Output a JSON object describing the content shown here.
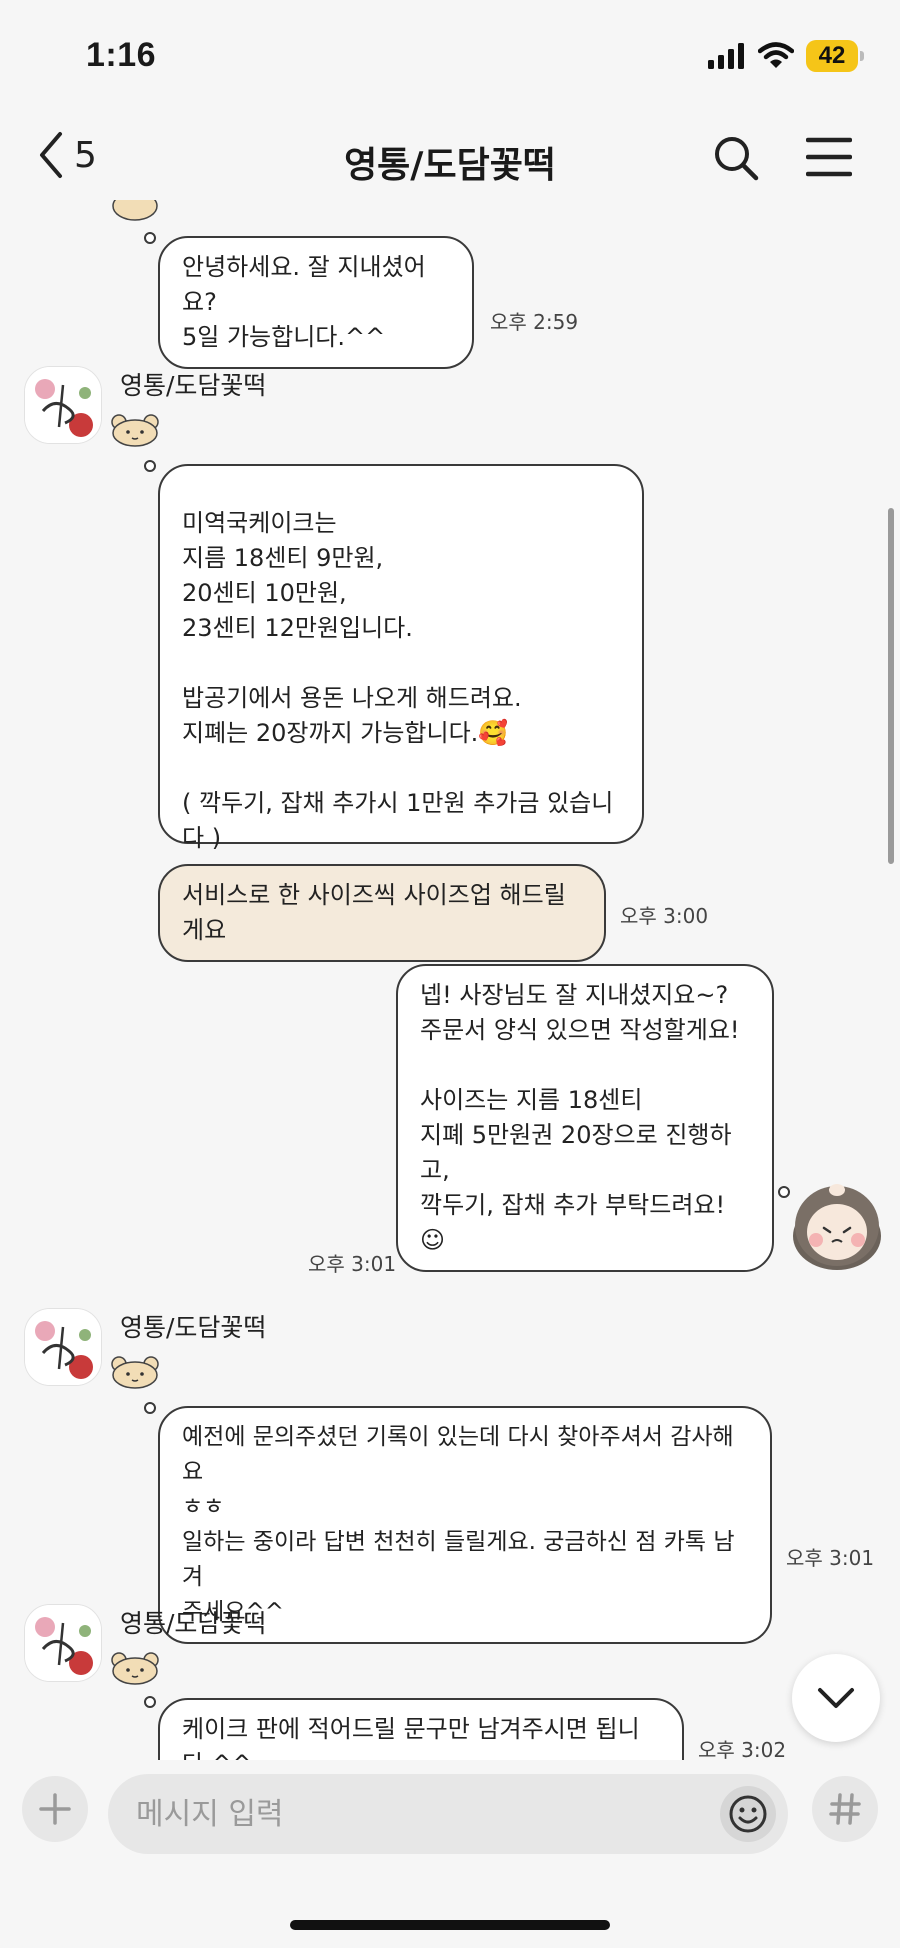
{
  "status_bar": {
    "time": "1:16",
    "battery": "42",
    "icons": [
      "signal-icon",
      "wifi-icon",
      "battery-icon"
    ],
    "battery_color": "#f5c518"
  },
  "header": {
    "back_count": "5",
    "title": "영통/도담꽃떡",
    "icons": [
      "back-arrow-icon",
      "search-icon",
      "menu-icon"
    ]
  },
  "messages": [
    {
      "id": "m1",
      "side": "received",
      "text": "안녕하세요. 잘 지내셨어요?\n5일 가능합니다.^^",
      "time": "오후 2:59"
    },
    {
      "id": "m2",
      "side": "received",
      "sender": "영통/도담꽃떡",
      "text": "미역국케이크는\n지름 18센티 9만원,\n20센티 10만원,\n23센티 12만원입니다.\n\n밥공기에서 용돈 나오게 해드려요.\n지폐는 20장까지 가능합니다.🥰\n\n( 깍두기, 잡채 추가시 1만원 추가금 있습니다 )"
    },
    {
      "id": "m3",
      "side": "received",
      "style": "beige",
      "text": "서비스로 한 사이즈씩 사이즈업 해드릴게요",
      "time": "오후 3:00"
    },
    {
      "id": "m4",
      "side": "sent",
      "text": "넵! 사장님도 잘 지내셨지요~?\n주문서 양식 있으면 작성할게요!\n\n사이즈는 지름 18센티\n지폐 5만원권 20장으로 진행하고,\n깍두기, 잡채 추가 부탁드려요! ☺",
      "time": "오후 3:01"
    },
    {
      "id": "m5",
      "side": "received",
      "sender": "영통/도담꽃떡",
      "text": "예전에 문의주셨던 기록이 있는데 다시 찾아주셔서 감사해요\nㅎㅎ\n일하는 중이라 답변 천천히 들릴게요. 궁금하신 점 카톡 남겨\n주세요^^",
      "time": "오후 3:01"
    },
    {
      "id": "m6",
      "side": "received",
      "sender": "영통/도담꽃떡",
      "text": "케이크 판에 적어드릴 문구만 남겨주시면 됩니다.^^",
      "time": "오후 3:02"
    }
  ],
  "input": {
    "placeholder": "메시지 입력",
    "icons": [
      "plus-icon",
      "emoji-icon",
      "hash-icon"
    ]
  },
  "colors": {
    "background": "#f6f6f6",
    "bubble": "#ffffff",
    "beige_bubble": "#f4eadb",
    "bubble_border": "#3a3a3a"
  }
}
